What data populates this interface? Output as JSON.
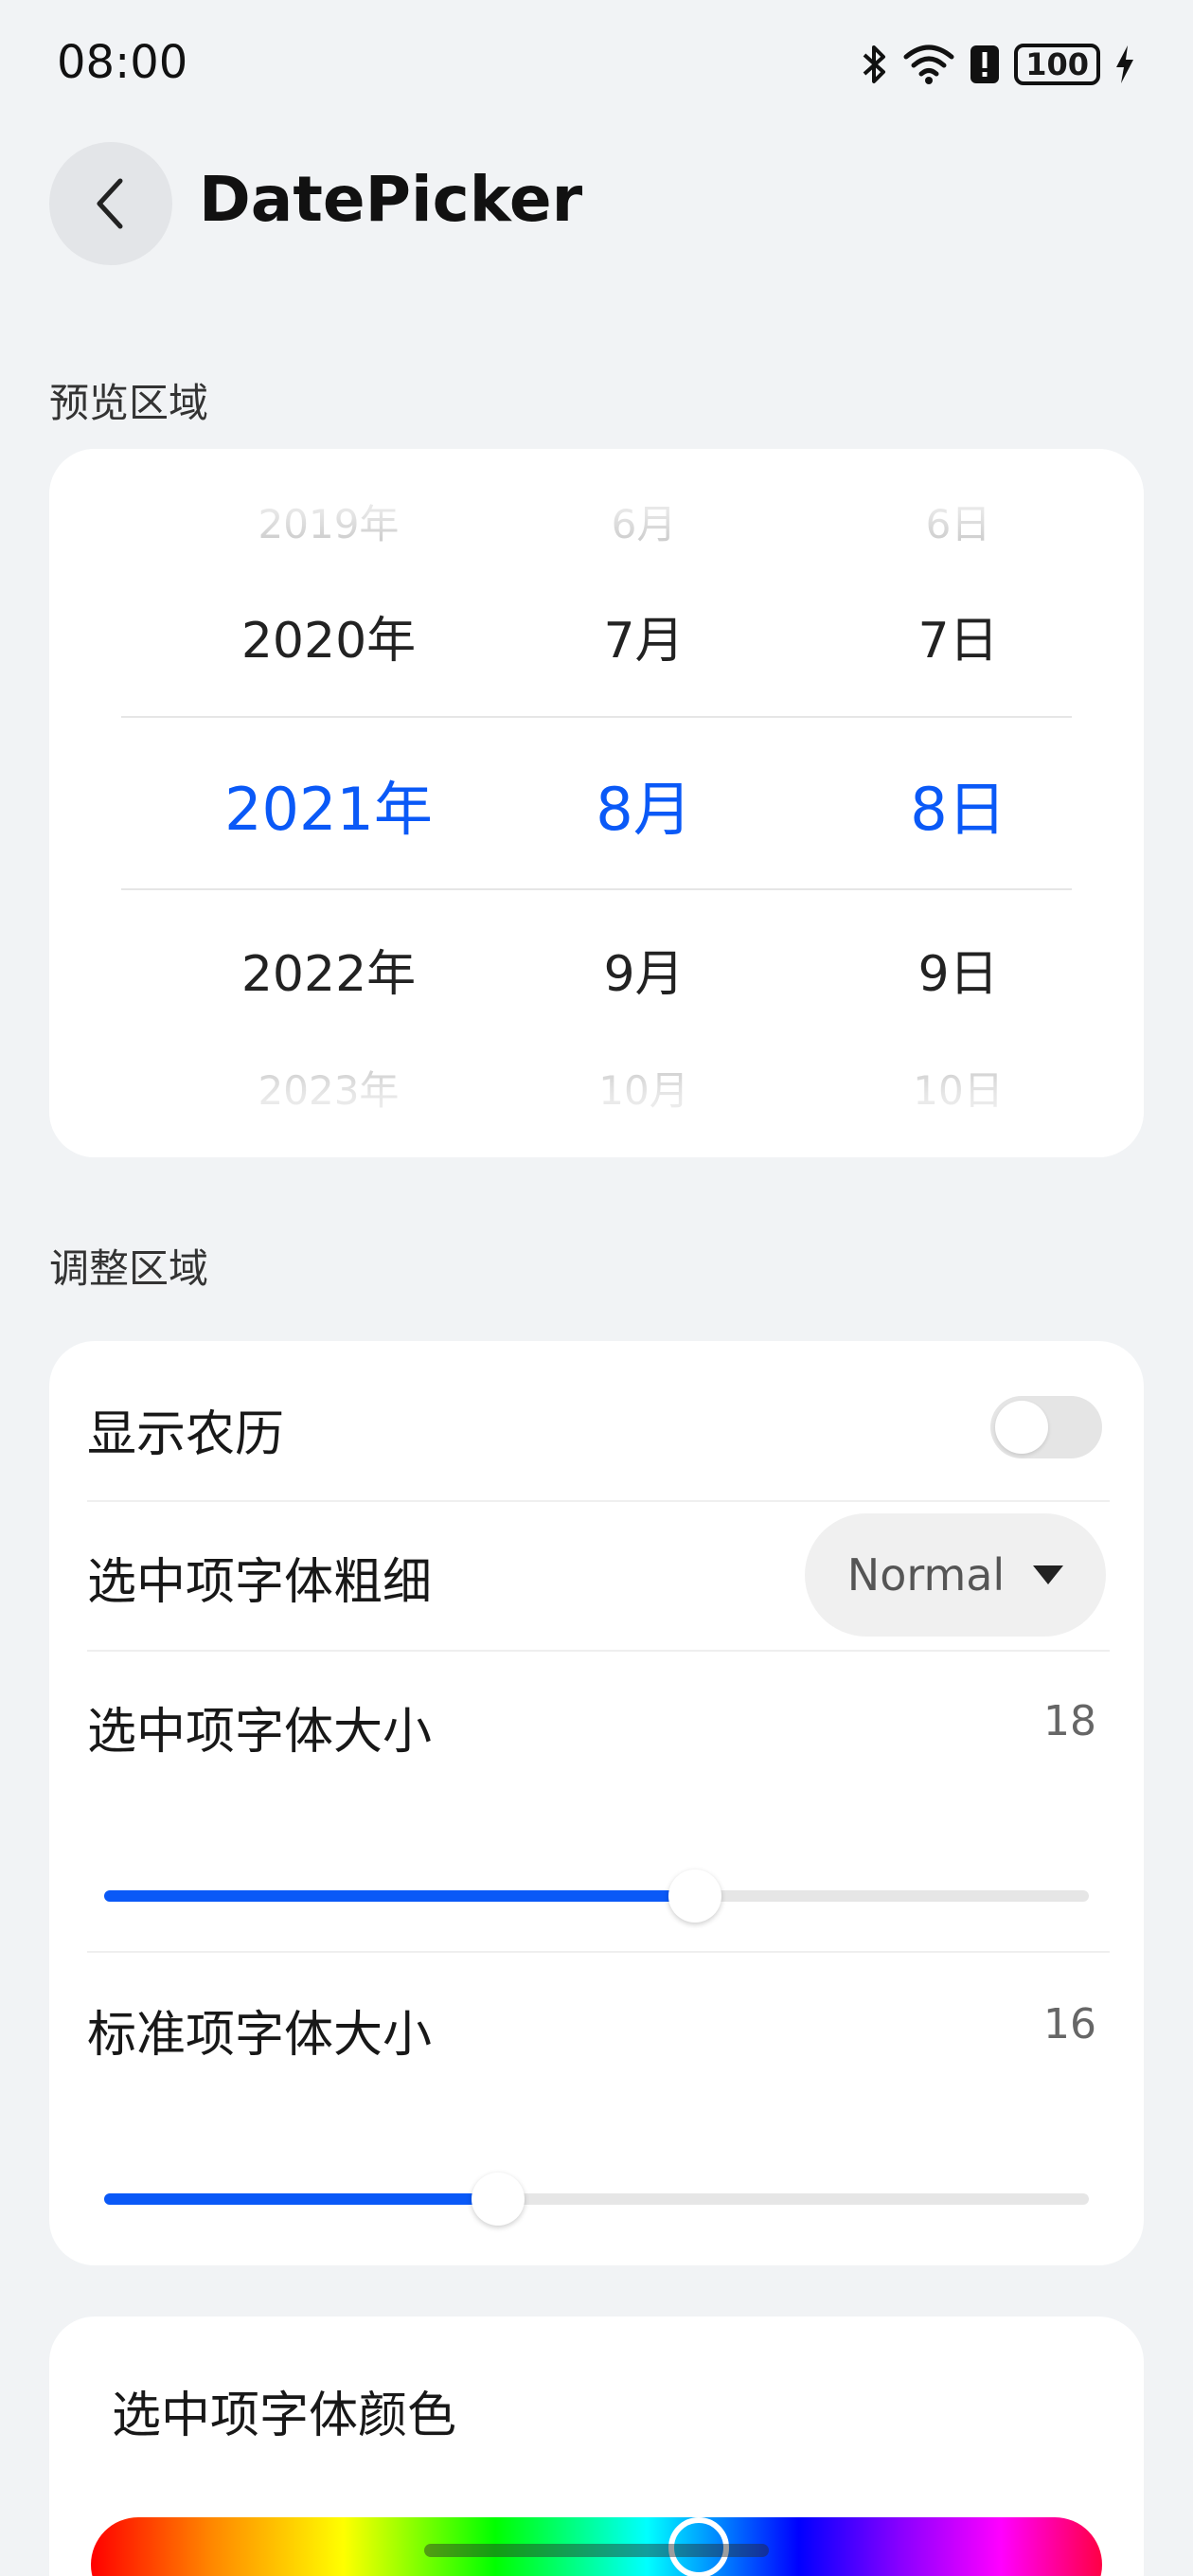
{
  "status_bar": {
    "time": "08:00",
    "battery": "100",
    "icons": [
      "bluetooth-icon",
      "wifi-icon",
      "alert-icon",
      "battery-icon",
      "charging-icon"
    ]
  },
  "header": {
    "title": "DatePicker"
  },
  "preview": {
    "section_label": "预览区域",
    "columns": [
      {
        "far_top": "2019年",
        "near_top": "2020年",
        "selected": "2021年",
        "near_bottom": "2022年",
        "far_bottom": "2023年"
      },
      {
        "far_top": "6月",
        "near_top": "7月",
        "selected": "8月",
        "near_bottom": "9月",
        "far_bottom": "10月"
      },
      {
        "far_top": "6日",
        "near_top": "7日",
        "selected": "8日",
        "near_bottom": "9日",
        "far_bottom": "10日"
      }
    ],
    "selected_color": "#0a59f7"
  },
  "adjust": {
    "section_label": "调整区域",
    "lunar": {
      "label": "显示农历",
      "on": false
    },
    "weight": {
      "label": "选中项字体粗细",
      "value": "Normal"
    },
    "selected_size": {
      "label": "选中项字体大小",
      "value": "18",
      "fraction": 0.6
    },
    "normal_size": {
      "label": "标准项字体大小",
      "value": "16",
      "fraction": 0.4
    }
  },
  "color": {
    "title": "选中项字体颜色"
  }
}
